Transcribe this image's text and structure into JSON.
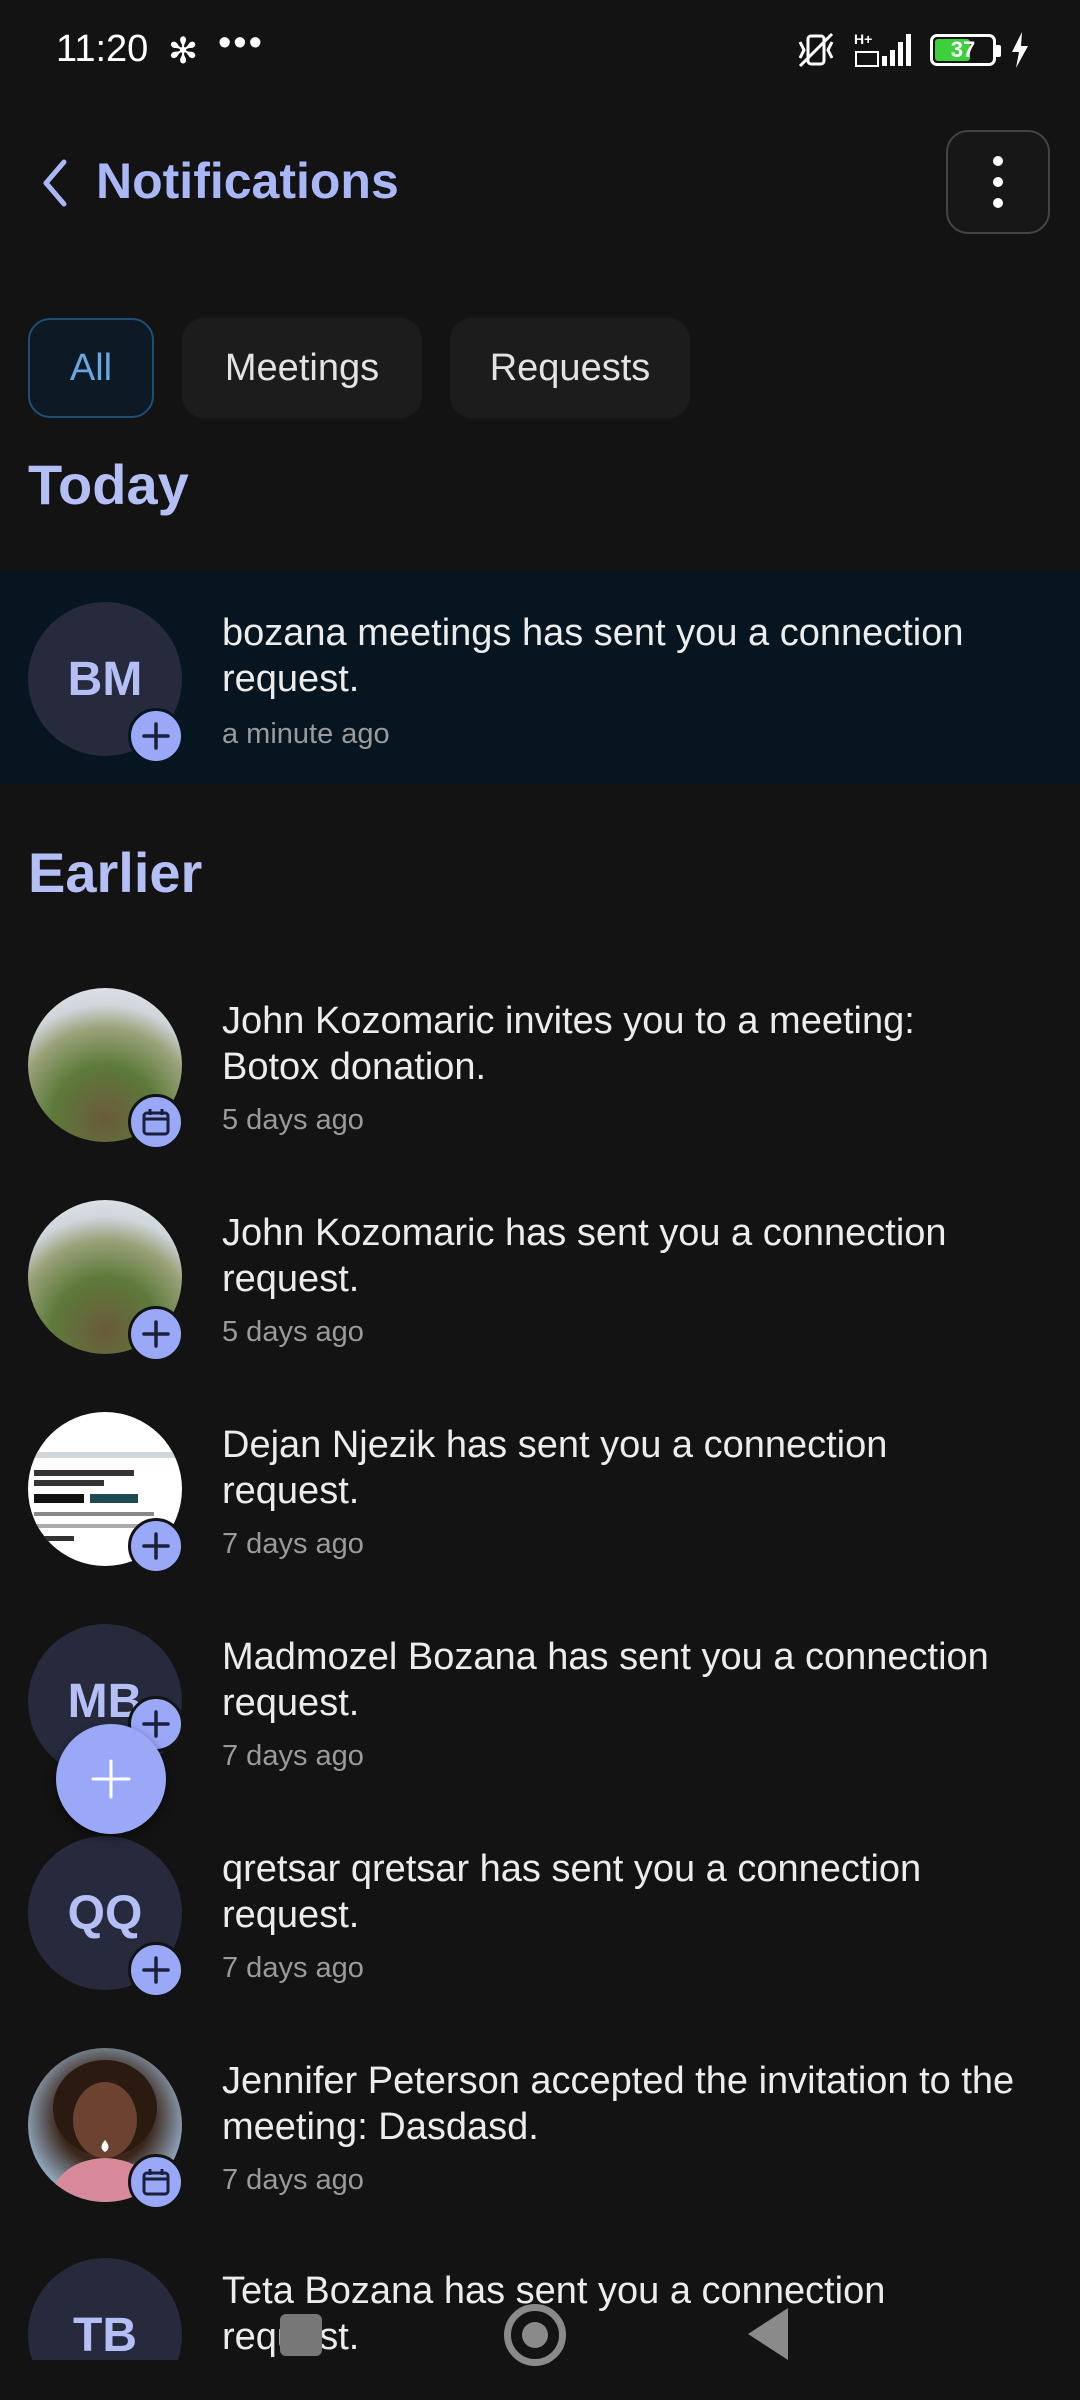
{
  "status_bar": {
    "time": "11:20",
    "left_icons": [
      "slack-icon",
      "more-dots-icon"
    ],
    "dots": "•••",
    "right_icons": [
      "vibrate-off-icon",
      "signal-hplus-icon",
      "battery-icon",
      "charging-icon"
    ],
    "network": "H+",
    "battery_level": "37"
  },
  "header": {
    "title": "Notifications",
    "back_icon": "chevron-left-icon",
    "menu_icon": "kebab-menu-icon"
  },
  "filters": [
    {
      "label": "All",
      "active": true
    },
    {
      "label": "Meetings",
      "active": false
    },
    {
      "label": "Requests",
      "active": false
    }
  ],
  "sections": {
    "today": "Today",
    "earlier": "Earlier"
  },
  "notifications": [
    {
      "initials": "BM",
      "text": "bozana meetings has sent you a connection request.",
      "time": "a minute ago",
      "badge": "plus-icon",
      "highlight": true
    },
    {
      "initials": "",
      "avatar": "photo",
      "text": "John Kozomaric invites you to a meeting: Botox donation.",
      "time": "5 days ago",
      "badge": "calendar-icon"
    },
    {
      "initials": "",
      "avatar": "photo",
      "text": "John Kozomaric has sent you a connection request.",
      "time": "5 days ago",
      "badge": "plus-icon"
    },
    {
      "initials": "",
      "avatar": "photo",
      "text": "Dejan Njezik has sent you a connection request.",
      "time": "7 days ago",
      "badge": "plus-icon"
    },
    {
      "initials": "MB",
      "text": "Madmozel Bozana has sent you a connection request.",
      "time": "7 days ago",
      "badge": "plus-icon"
    },
    {
      "initials": "QQ",
      "text": "qretsar qretsar has sent you a connection request.",
      "time": "7 days ago",
      "badge": "plus-icon"
    },
    {
      "initials": "",
      "avatar": "photo",
      "text": "Jennifer Peterson accepted the invitation to the meeting: Dasdasd.",
      "time": "7 days ago",
      "badge": "calendar-icon"
    },
    {
      "initials": "TB",
      "text": "Teta Bozana has sent you a connection request.",
      "time": "",
      "badge": "plus-icon"
    }
  ],
  "fab": {
    "icon": "plus-icon"
  },
  "nav_bar": {
    "icons": [
      "square-home-icon",
      "circle-recents-icon",
      "triangle-back-icon"
    ]
  },
  "colors": {
    "background": "#131313",
    "accent": "#9aa8f8",
    "title": "#a9b7f7",
    "highlight_row": "#061520",
    "active_chip_text": "#6aa6e0"
  }
}
